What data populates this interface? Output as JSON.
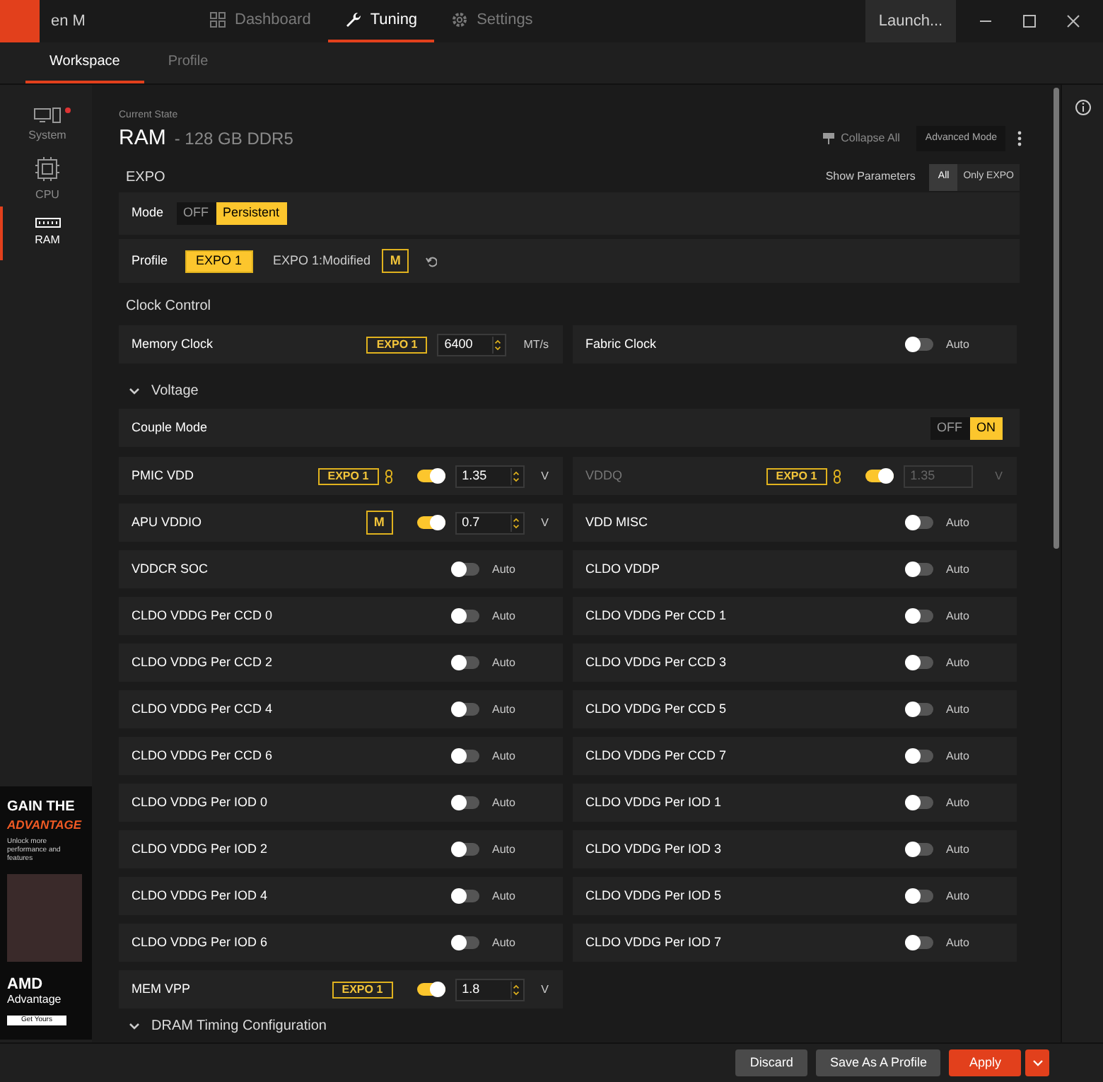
{
  "window": {
    "title": "en M",
    "launch_button": "Launch..."
  },
  "nav_tabs": [
    {
      "label": "Dashboard",
      "selected": false
    },
    {
      "label": "Tuning",
      "selected": true
    },
    {
      "label": "Settings",
      "selected": false
    }
  ],
  "sub_tabs": [
    {
      "label": "Workspace",
      "selected": true
    },
    {
      "label": "Profile",
      "selected": false
    }
  ],
  "sidebar": {
    "items": [
      {
        "label": "System",
        "alert": true,
        "selected": false
      },
      {
        "label": "CPU",
        "alert": false,
        "selected": false
      },
      {
        "label": "RAM",
        "alert": false,
        "selected": true
      }
    ],
    "ad": {
      "headline": "GAIN THE",
      "headline_accent": "ADVANTAGE",
      "tagline": "Unlock more performance and features",
      "brand": "AMD",
      "brand_sub": "Advantage",
      "cta": "Get Yours"
    }
  },
  "header": {
    "caption": "Current State",
    "title": "RAM",
    "subtitle": "- 128 GB DDR5",
    "collapse_all": "Collapse All",
    "advanced_mode": "Advanced Mode"
  },
  "expo": {
    "title": "EXPO",
    "show_parameters": {
      "label": "Show Parameters",
      "options": [
        {
          "label": "All",
          "selected": true
        },
        {
          "label": "Only EXPO",
          "selected": false
        }
      ]
    },
    "mode": {
      "label": "Mode",
      "options": [
        {
          "label": "OFF",
          "selected": false
        },
        {
          "label": "Persistent",
          "selected": true
        }
      ]
    },
    "profile": {
      "label": "Profile",
      "options": [
        {
          "label": "EXPO 1",
          "selected": true
        },
        {
          "label": "EXPO 1:Modified",
          "selected": false
        }
      ],
      "modified_badge": "M"
    }
  },
  "clock_control": {
    "title": "Clock Control",
    "rows": [
      {
        "label": "Memory Clock",
        "kind": "value",
        "badge": {
          "text": "EXPO 1",
          "kind": "expo"
        },
        "linked": false,
        "disabled": false,
        "value": "6400",
        "unit": "MT/s"
      },
      {
        "label": "Fabric Clock",
        "kind": "auto",
        "on": false,
        "status": "Auto"
      }
    ]
  },
  "voltage": {
    "title": "Voltage",
    "expanded": true,
    "couple_mode": {
      "label": "Couple Mode",
      "options": [
        {
          "label": "OFF",
          "selected": false
        },
        {
          "label": "ON",
          "selected": true
        }
      ]
    },
    "rows": [
      {
        "label": "PMIC VDD",
        "kind": "value",
        "badge": {
          "text": "EXPO 1",
          "kind": "expo"
        },
        "linked": true,
        "on": true,
        "disabled": false,
        "value": "1.35",
        "unit": "V"
      },
      {
        "label": "VDDQ",
        "kind": "value",
        "badge": {
          "text": "EXPO 1",
          "kind": "expo"
        },
        "linked": true,
        "on": true,
        "disabled": true,
        "value": "1.35",
        "unit": "V"
      },
      {
        "label": "APU VDDIO",
        "kind": "value",
        "badge": {
          "text": "M",
          "kind": "m"
        },
        "linked": false,
        "on": true,
        "disabled": false,
        "value": "0.7",
        "unit": "V"
      },
      {
        "label": "VDD MISC",
        "kind": "auto",
        "on": false,
        "status": "Auto"
      },
      {
        "label": "VDDCR SOC",
        "kind": "auto",
        "on": false,
        "status": "Auto"
      },
      {
        "label": "CLDO VDDP",
        "kind": "auto",
        "on": false,
        "status": "Auto"
      },
      {
        "label": "CLDO VDDG Per CCD 0",
        "kind": "auto",
        "on": false,
        "status": "Auto"
      },
      {
        "label": "CLDO VDDG Per CCD 1",
        "kind": "auto",
        "on": false,
        "status": "Auto"
      },
      {
        "label": "CLDO VDDG Per CCD 2",
        "kind": "auto",
        "on": false,
        "status": "Auto"
      },
      {
        "label": "CLDO VDDG Per CCD 3",
        "kind": "auto",
        "on": false,
        "status": "Auto"
      },
      {
        "label": "CLDO VDDG Per CCD 4",
        "kind": "auto",
        "on": false,
        "status": "Auto"
      },
      {
        "label": "CLDO VDDG Per CCD 5",
        "kind": "auto",
        "on": false,
        "status": "Auto"
      },
      {
        "label": "CLDO VDDG Per CCD 6",
        "kind": "auto",
        "on": false,
        "status": "Auto"
      },
      {
        "label": "CLDO VDDG Per CCD 7",
        "kind": "auto",
        "on": false,
        "status": "Auto"
      },
      {
        "label": "CLDO VDDG Per IOD 0",
        "kind": "auto",
        "on": false,
        "status": "Auto"
      },
      {
        "label": "CLDO VDDG Per IOD 1",
        "kind": "auto",
        "on": false,
        "status": "Auto"
      },
      {
        "label": "CLDO VDDG Per IOD 2",
        "kind": "auto",
        "on": false,
        "status": "Auto"
      },
      {
        "label": "CLDO VDDG Per IOD 3",
        "kind": "auto",
        "on": false,
        "status": "Auto"
      },
      {
        "label": "CLDO VDDG Per IOD 4",
        "kind": "auto",
        "on": false,
        "status": "Auto"
      },
      {
        "label": "CLDO VDDG Per IOD 5",
        "kind": "auto",
        "on": false,
        "status": "Auto"
      },
      {
        "label": "CLDO VDDG Per IOD 6",
        "kind": "auto",
        "on": false,
        "status": "Auto"
      },
      {
        "label": "CLDO VDDG Per IOD 7",
        "kind": "auto",
        "on": false,
        "status": "Auto"
      },
      {
        "label": "MEM VPP",
        "kind": "value",
        "badge": {
          "text": "EXPO 1",
          "kind": "expo"
        },
        "linked": false,
        "on": true,
        "disabled": false,
        "value": "1.8",
        "unit": "V"
      }
    ]
  },
  "dram_timing": {
    "title": "DRAM Timing Configuration",
    "expanded": true
  },
  "footer": {
    "buttons": [
      {
        "label": "Discard",
        "kind": "secondary"
      },
      {
        "label": "Save As A Profile",
        "kind": "secondary"
      },
      {
        "label": "Apply",
        "kind": "primary"
      }
    ]
  }
}
